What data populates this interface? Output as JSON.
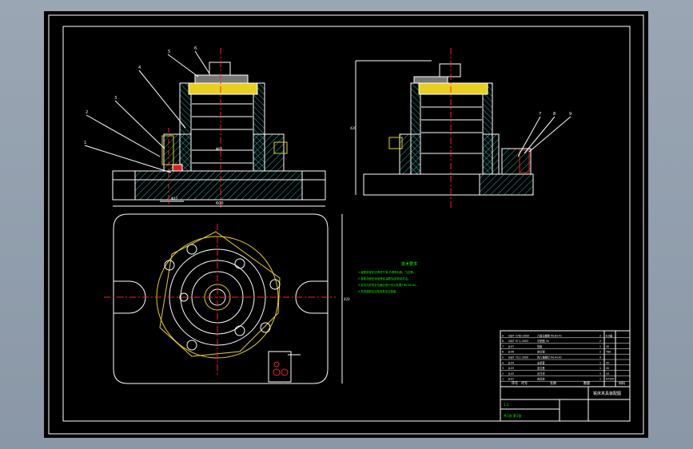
{
  "drawing": {
    "tech_requirements": {
      "title": "技术要求",
      "lines": [
        "1.装配前零件应清洗干净,不得有毛刺、飞边等。",
        "2.各配合面应涂润滑油,装配后应转动灵活。",
        "3.定位元件的定位面应进行淬火处理,HRC58-62。",
        "4.夹具装配后应检验其定位精度。"
      ]
    },
    "callouts": [
      "1",
      "2",
      "3",
      "4",
      "5",
      "6",
      "7",
      "8",
      "9"
    ],
    "dimensions": {
      "width": "600",
      "height": "420",
      "bore": "Φ80",
      "hole": "Φ12"
    },
    "title_block": {
      "part_rows": [
        [
          "9",
          "GB/T 5782-2000",
          "六角头螺栓 M16×70",
          "2",
          "8.8级"
        ],
        [
          "8",
          "GB/T 97.1-2002",
          "平垫圈 16",
          "2",
          ""
        ],
        [
          "7",
          "JJ-07",
          "压板",
          "1",
          "45"
        ],
        [
          "6",
          "JJ-06",
          "定位销",
          "2",
          "T8A"
        ],
        [
          "5",
          "GB/T 70.1-2000",
          "内六角螺钉 M10×30",
          "4",
          ""
        ],
        [
          "4",
          "JJ-04",
          "支承套",
          "1",
          "45"
        ],
        [
          "3",
          "JJ-03",
          "定位盘",
          "1",
          "45"
        ],
        [
          "2",
          "JJ-02",
          "对刀块",
          "1",
          "20"
        ],
        [
          "1",
          "JJ-01",
          "夹具体",
          "1",
          "HT200"
        ]
      ],
      "header": [
        "序号",
        "代号",
        "名称",
        "数量",
        "材料"
      ],
      "drawing_title": "铣床夹具装配图",
      "scale": "1:1",
      "sheet": "共1张 第1张"
    }
  },
  "colors": {
    "background": "#000000",
    "frame": "#ffffff",
    "outline": "#ffffff",
    "hidden": "#ffff00",
    "center": "#ff2020",
    "hatch": "#1fb6a8",
    "text": "#00ff00",
    "title_text": "#00ff00"
  }
}
